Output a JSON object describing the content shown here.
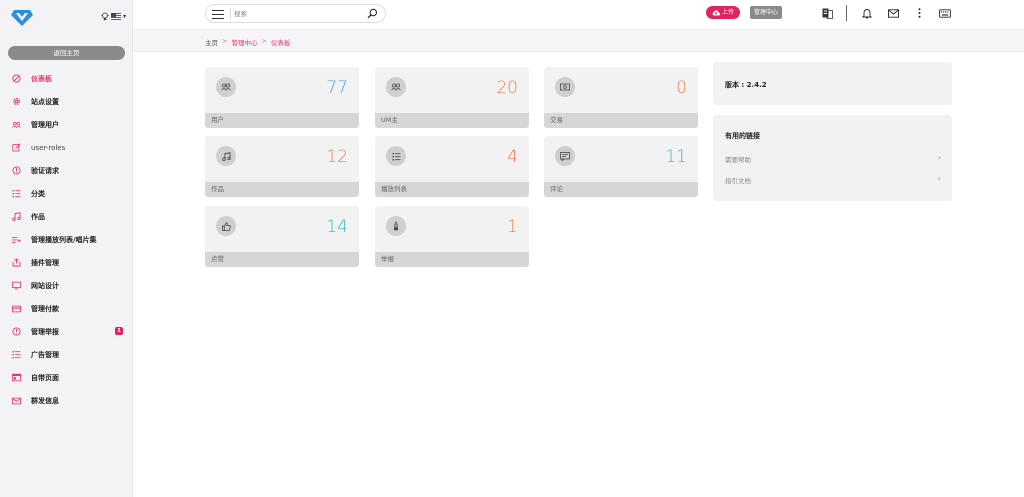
{
  "sidebar": {
    "home_button": "返回主页",
    "items": [
      {
        "label": "仪表板",
        "icon": "dashboard-icon"
      },
      {
        "label": "站点设置",
        "icon": "settings-gear-icon"
      },
      {
        "label": "管理用户",
        "icon": "users-icon"
      },
      {
        "label": "user-roles",
        "icon": "edit-icon"
      },
      {
        "label": "验证请求",
        "icon": "info-circle-icon"
      },
      {
        "label": "分类",
        "icon": "list-icon"
      },
      {
        "label": "作品",
        "icon": "music-note-icon"
      },
      {
        "label": "管理播放列表/唱片集",
        "icon": "playlist-icon"
      },
      {
        "label": "插件管理",
        "icon": "plugin-icon"
      },
      {
        "label": "网站设计",
        "icon": "monitor-icon"
      },
      {
        "label": "管理付款",
        "icon": "payment-icon"
      },
      {
        "label": "管理举报",
        "icon": "report-icon",
        "badge": "1"
      },
      {
        "label": "广告管理",
        "icon": "ads-list-icon"
      },
      {
        "label": "自带页面",
        "icon": "pages-icon"
      },
      {
        "label": "群发信息",
        "icon": "mail-icon"
      }
    ]
  },
  "header": {
    "search_placeholder": "搜索",
    "upload_label": "上传",
    "admin_label": "管理中心"
  },
  "breadcrumb": {
    "home": "主页",
    "separator": ">",
    "admin": "管理中心",
    "current": "仪表板"
  },
  "stats": [
    {
      "label": "用户",
      "value": "77",
      "color": "#4fa3d9",
      "icon": "users-icon"
    },
    {
      "label": "UM主",
      "value": "20",
      "color": "#f07a4f",
      "icon": "artists-icon"
    },
    {
      "label": "交易",
      "value": "0",
      "color": "#f07a4f",
      "icon": "money-icon"
    },
    {
      "label": "作品",
      "value": "12",
      "color": "#f07a4f",
      "icon": "music-note-icon"
    },
    {
      "label": "播放列表",
      "value": "4",
      "color": "#f07a4f",
      "icon": "list-icon"
    },
    {
      "label": "评论",
      "value": "11",
      "color": "#3fb2c9",
      "icon": "comment-icon"
    },
    {
      "label": "点赞",
      "value": "14",
      "color": "#3fb2c9",
      "icon": "thumbs-up-icon"
    },
    {
      "label": "举报",
      "value": "1",
      "color": "#f07a4f",
      "icon": "flag-report-icon"
    }
  ],
  "version": {
    "text": "版本 : 2.4.2"
  },
  "useful_links": {
    "title": "有用的链接",
    "items": [
      "需要帮助",
      "指引文档"
    ]
  },
  "colors": {
    "accent": "#e8336d",
    "upload": "#e0245e"
  }
}
